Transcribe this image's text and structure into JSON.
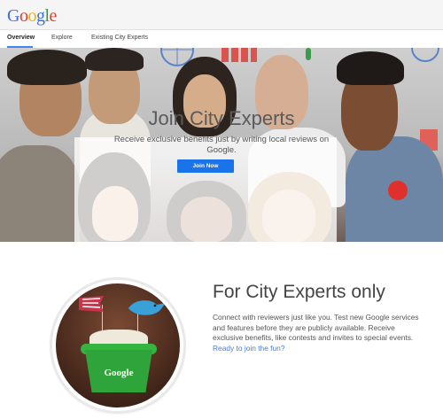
{
  "header": {
    "logo_letters": [
      "G",
      "o",
      "o",
      "g",
      "l",
      "e"
    ],
    "logo_colors": [
      "#3b6fe0",
      "#d9412f",
      "#f0b400",
      "#3b6fe0",
      "#2f9a3e",
      "#d9412f"
    ]
  },
  "nav": {
    "items": [
      "Overview",
      "Explore",
      "Existing City Experts"
    ],
    "active_index": 0
  },
  "hero": {
    "title": "Join City Experts",
    "subtitle": "Receive exclusive benefits just by writing local reviews on Google.",
    "button_label": "Join Now",
    "button_color": "#1a73e8"
  },
  "promo": {
    "image_cup_text": "Google",
    "title": "For City Experts only",
    "body": "Connect with reviewers just like you. Test new Google services and features before they are publicly available. Receive exclusive benefits, like contests and invites to special events.",
    "link_text": "Ready to join the fun?",
    "link_color": "#4a7bd1"
  }
}
